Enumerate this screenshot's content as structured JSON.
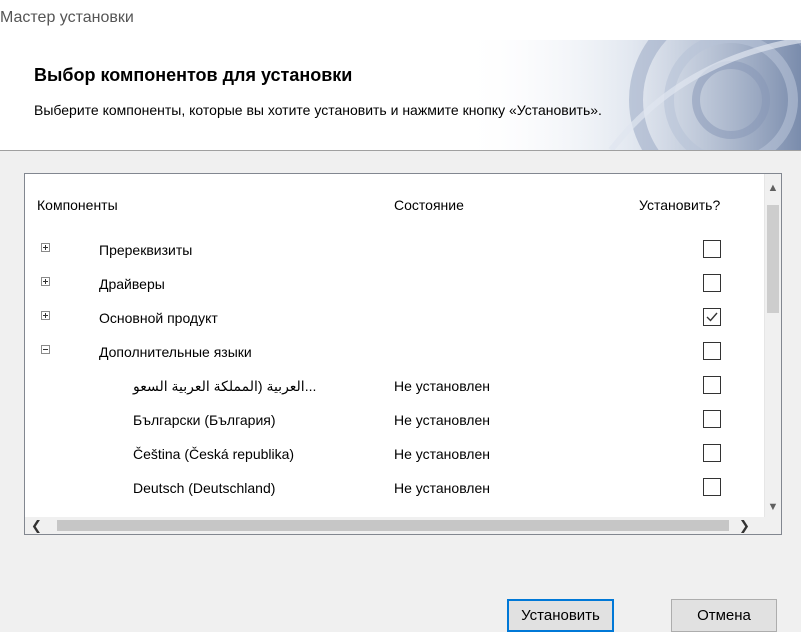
{
  "window": {
    "title": "Мастер установки"
  },
  "header": {
    "title": "Выбор компонентов для установки",
    "subtitle": "Выберите компоненты, которые вы хотите установить и нажмите кнопку «Установить»."
  },
  "table": {
    "columns": [
      "Компоненты",
      "Состояние",
      "Установить?"
    ],
    "rows": [
      {
        "name": "Пререквизиты",
        "status": "",
        "expander": "plus",
        "checked": false,
        "level": 0
      },
      {
        "name": "Драйверы",
        "status": "",
        "expander": "plus",
        "checked": false,
        "level": 0
      },
      {
        "name": "Основной продукт",
        "status": "",
        "expander": "plus",
        "checked": true,
        "level": 0
      },
      {
        "name": "Дополнительные языки",
        "status": "",
        "expander": "minus",
        "checked": false,
        "level": 0
      },
      {
        "name": "العربية (المملكة العربية السعو...",
        "status": "Не установлен",
        "expander": "",
        "checked": false,
        "level": 1
      },
      {
        "name": "Български (България)",
        "status": "Не установлен",
        "expander": "",
        "checked": false,
        "level": 1
      },
      {
        "name": "Čeština (Česká republika)",
        "status": "Не установлен",
        "expander": "",
        "checked": false,
        "level": 1
      },
      {
        "name": "Deutsch (Deutschland)",
        "status": "Не установлен",
        "expander": "",
        "checked": false,
        "level": 1
      }
    ]
  },
  "scrollbar": {
    "up_icon": "chevron-up-icon",
    "down_icon": "chevron-down-icon",
    "left_icon": "chevron-left-icon",
    "right_icon": "chevron-right-icon"
  },
  "buttons": {
    "install": "Установить",
    "cancel": "Отмена"
  },
  "colors": {
    "accent": "#0078d7",
    "check": "#333333"
  }
}
